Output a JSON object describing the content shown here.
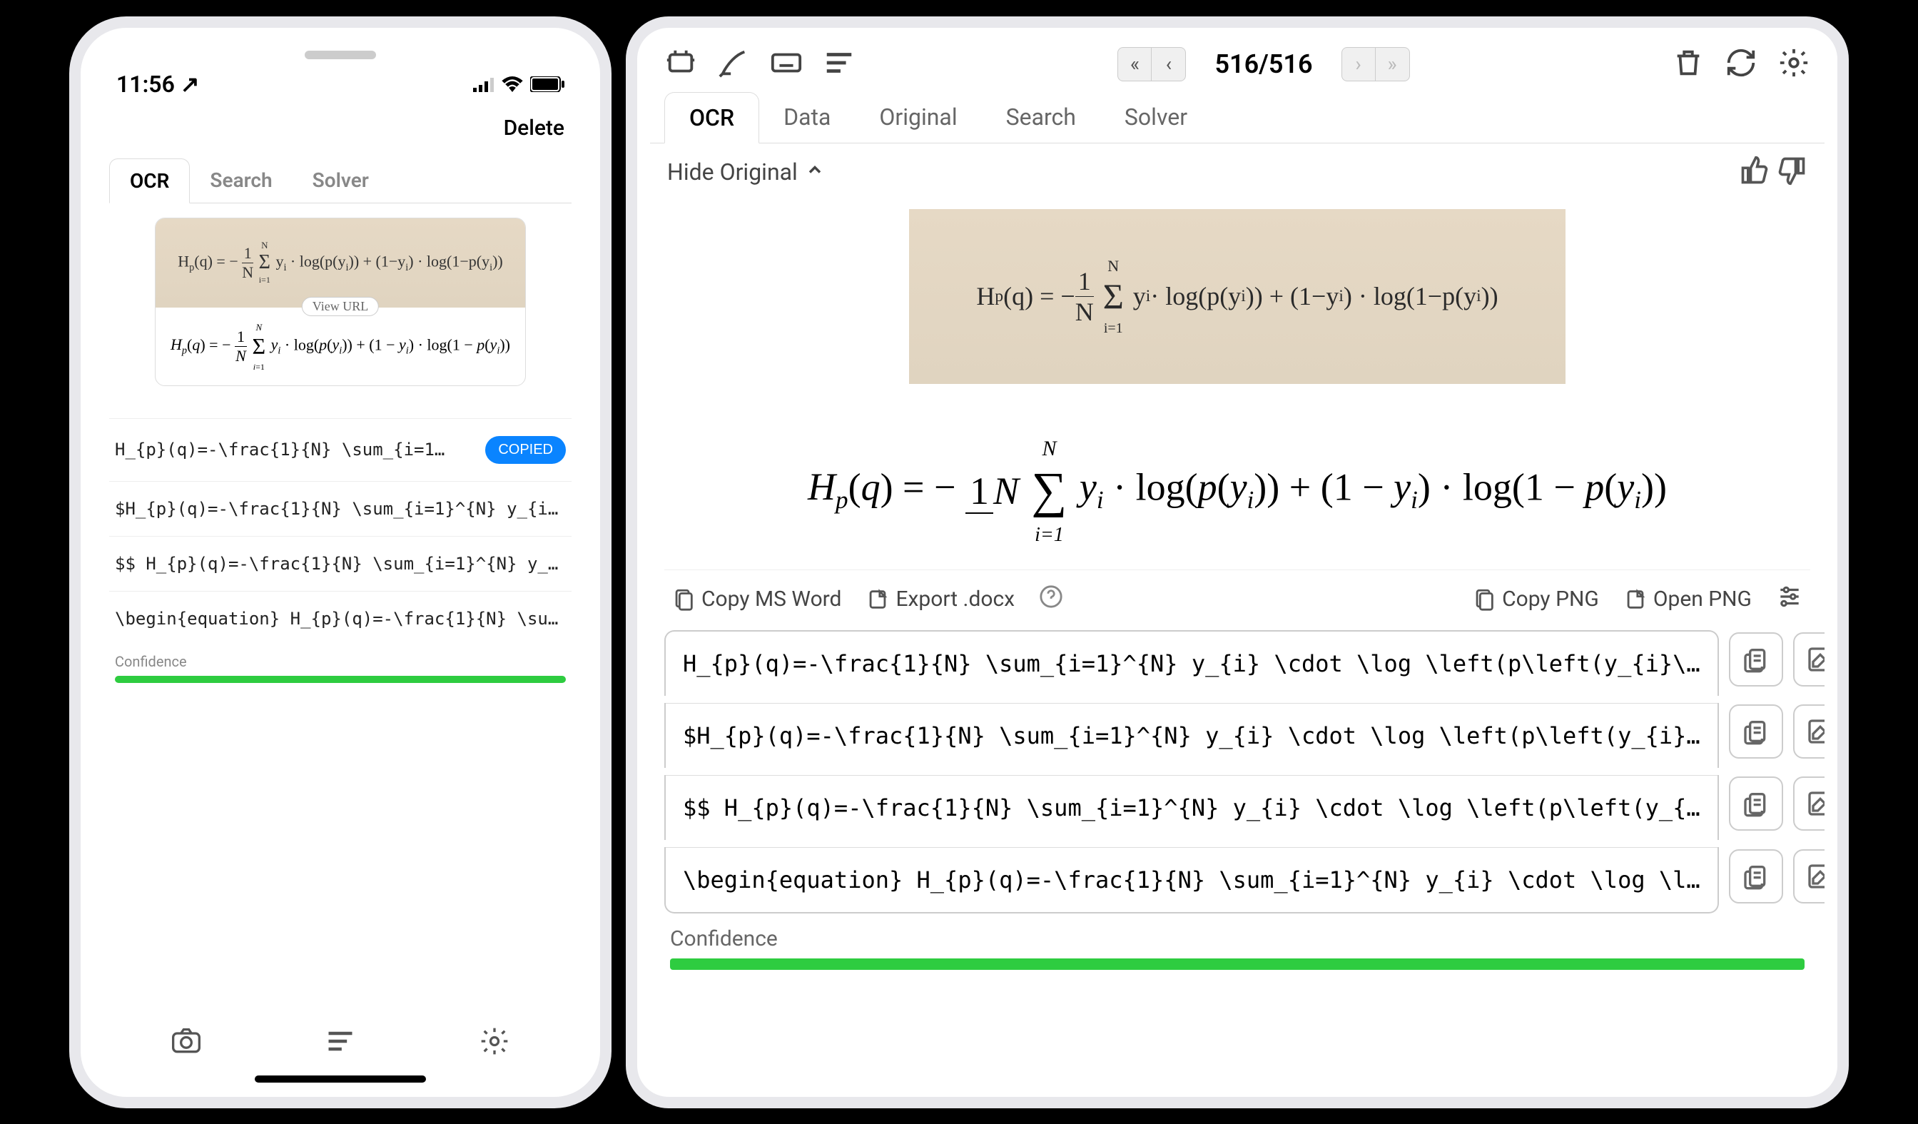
{
  "phone": {
    "time": "11:56 ↗",
    "delete": "Delete",
    "tabs": [
      "OCR",
      "Search",
      "Solver"
    ],
    "view_url": "View URL",
    "handwritten": "H_p(q) = − 1/N Σ yᵢ · log(p(yᵢ)) + (1−yᵢ) · log(1−p(yᵢ))",
    "rendered": "H_p(q) = − 1/N Σ yᵢ · log(p(yᵢ)) + (1 − yᵢ) · log(1 − p(yᵢ))",
    "copied": "COPIED",
    "latex_rows": [
      "H_{p}(q)=-\\frac{1}{N} \\sum_{i=1…",
      "$H_{p}(q)=-\\frac{1}{N} \\sum_{i=1}^{N} y_{i…",
      "$$ H_{p}(q)=-\\frac{1}{N} \\sum_{i=1}^{N} y_…",
      "\\begin{equation} H_{p}(q)=-\\frac{1}{N} \\su…"
    ],
    "confidence_label": "Confidence"
  },
  "desktop": {
    "page_count": "516/516",
    "tabs": [
      "OCR",
      "Data",
      "Original",
      "Search",
      "Solver"
    ],
    "hide_original": "Hide Original",
    "handwritten": "H_p(q) = − 1/N Σ yᵢ · log(p(yᵢ)) + (1−yᵢ) · log(1−p(yᵢ))",
    "actions": {
      "copy_ms_word": "Copy MS Word",
      "export_docx": "Export .docx",
      "copy_png": "Copy PNG",
      "open_png": "Open PNG"
    },
    "latex_rows": [
      "H_{p}(q)=-\\frac{1}{N} \\sum_{i=1}^{N} y_{i} \\cdot \\log \\left(p\\left(y_{i}\\…",
      "$H_{p}(q)=-\\frac{1}{N} \\sum_{i=1}^{N} y_{i} \\cdot \\log \\left(p\\left(y_{i}…",
      "$$ H_{p}(q)=-\\frac{1}{N} \\sum_{i=1}^{N} y_{i} \\cdot \\log \\left(p\\left(y_{…",
      "\\begin{equation} H_{p}(q)=-\\frac{1}{N} \\sum_{i=1}^{N} y_{i} \\cdot \\log \\l…"
    ],
    "confidence_label": "Confidence"
  }
}
